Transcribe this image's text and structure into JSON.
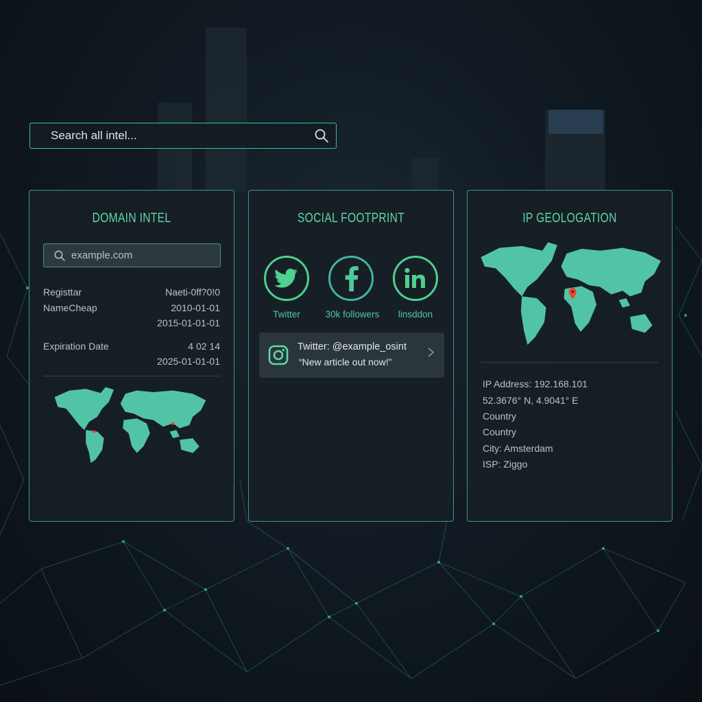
{
  "search": {
    "placeholder": "Search all intel..."
  },
  "domain_intel": {
    "title": "DOMAIN INTEL",
    "search_value": "example.com",
    "rows": [
      {
        "left": "Registtar",
        "right": "Naeti-0ff?0!0"
      },
      {
        "left": "NameCheap",
        "right": "2010-01-01"
      },
      {
        "left": "",
        "right": "2015-01-01-01"
      },
      {
        "left": "Expiration Date",
        "right": "4 02 14"
      },
      {
        "left": "",
        "right": "2025-01-01-01"
      }
    ]
  },
  "social_footprint": {
    "title": "SOCIAL FOOTPRINT",
    "networks": [
      {
        "icon": "twitter-icon",
        "caption": "Twitter"
      },
      {
        "icon": "facebook-icon",
        "caption": "30k followers"
      },
      {
        "icon": "linkedin-icon",
        "caption": "linsddon"
      }
    ],
    "feed": {
      "icon": "instagram-icon",
      "handle": "Twitter: @example_osint",
      "post": "“New article out now!”"
    }
  },
  "ip_geolocation": {
    "title": "IP GEOLOGATION",
    "details": [
      "IP Address: 192.168.101",
      "52.3676° N, 4.9041° E",
      "Country",
      "Country",
      "City: Amsterdam",
      "ISP: Ziggo"
    ]
  },
  "colors": {
    "accent": "#5fd8a4",
    "map_fill": "#52c4a6",
    "marker": "#e8452e",
    "panel_bg": "#171f26"
  }
}
